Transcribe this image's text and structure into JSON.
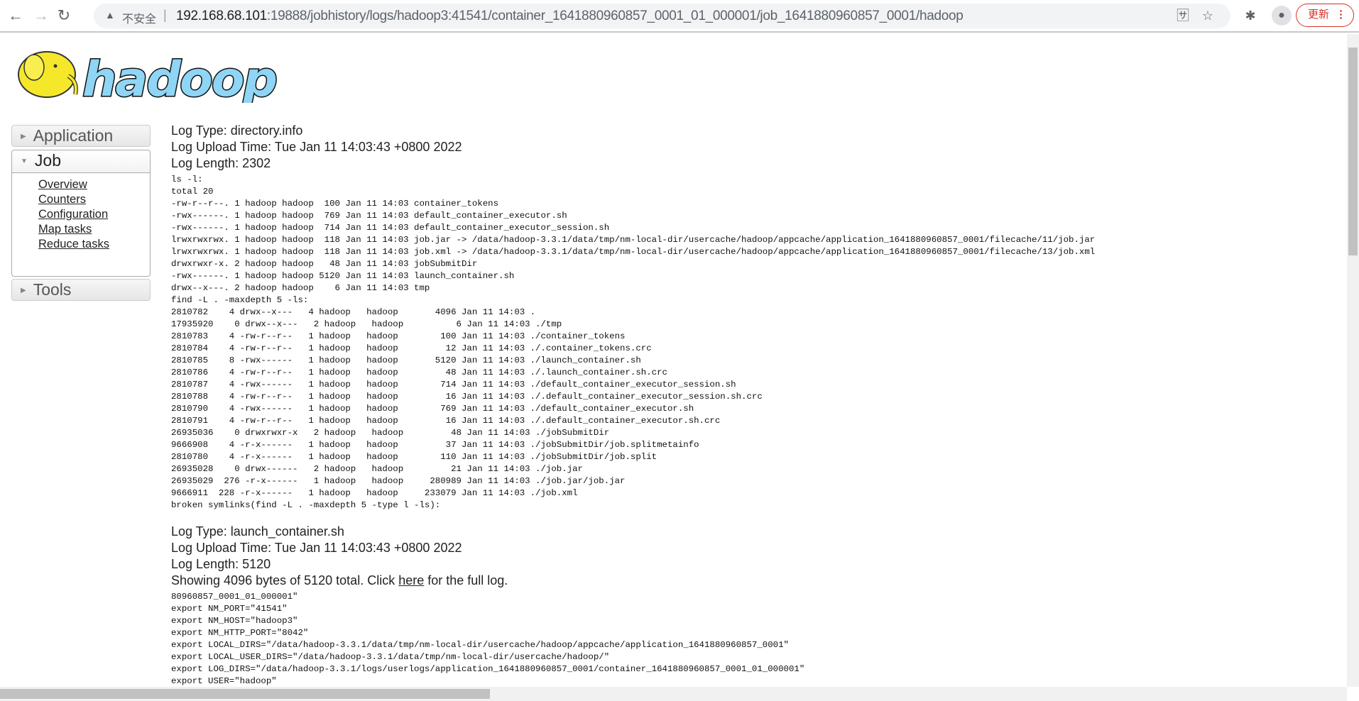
{
  "browser": {
    "security_label": "不安全",
    "url_host": "192.168.68.101",
    "url_rest": ":19888/jobhistory/logs/hadoop3:41541/container_1641880960857_0001_01_000001/job_1641880960857_0001/hadoop",
    "update_label": "更新"
  },
  "logo": {
    "text": "hadoop"
  },
  "sidebar": {
    "application": "Application",
    "job": "Job",
    "job_links": [
      "Overview",
      "Counters",
      "Configuration",
      "Map tasks",
      "Reduce tasks"
    ],
    "tools": "Tools"
  },
  "logs": [
    {
      "type": "Log Type: directory.info",
      "upload_time": "Log Upload Time: Tue Jan 11 14:03:43 +0800 2022",
      "length": "Log Length: 2302",
      "lines": [
        "ls -l:",
        "total 20",
        "-rw-r--r--. 1 hadoop hadoop  100 Jan 11 14:03 container_tokens",
        "-rwx------. 1 hadoop hadoop  769 Jan 11 14:03 default_container_executor.sh",
        "-rwx------. 1 hadoop hadoop  714 Jan 11 14:03 default_container_executor_session.sh",
        "lrwxrwxrwx. 1 hadoop hadoop  118 Jan 11 14:03 job.jar -> /data/hadoop-3.3.1/data/tmp/nm-local-dir/usercache/hadoop/appcache/application_1641880960857_0001/filecache/11/job.jar",
        "lrwxrwxrwx. 1 hadoop hadoop  118 Jan 11 14:03 job.xml -> /data/hadoop-3.3.1/data/tmp/nm-local-dir/usercache/hadoop/appcache/application_1641880960857_0001/filecache/13/job.xml",
        "drwxrwxr-x. 2 hadoop hadoop   48 Jan 11 14:03 jobSubmitDir",
        "-rwx------. 1 hadoop hadoop 5120 Jan 11 14:03 launch_container.sh",
        "drwx--x---. 2 hadoop hadoop    6 Jan 11 14:03 tmp",
        "find -L . -maxdepth 5 -ls:",
        "2810782    4 drwx--x---   4 hadoop   hadoop       4096 Jan 11 14:03 .",
        "17935920    0 drwx--x---   2 hadoop   hadoop          6 Jan 11 14:03 ./tmp",
        "2810783    4 -rw-r--r--   1 hadoop   hadoop        100 Jan 11 14:03 ./container_tokens",
        "2810784    4 -rw-r--r--   1 hadoop   hadoop         12 Jan 11 14:03 ./.container_tokens.crc",
        "2810785    8 -rwx------   1 hadoop   hadoop       5120 Jan 11 14:03 ./launch_container.sh",
        "2810786    4 -rw-r--r--   1 hadoop   hadoop         48 Jan 11 14:03 ./.launch_container.sh.crc",
        "2810787    4 -rwx------   1 hadoop   hadoop        714 Jan 11 14:03 ./default_container_executor_session.sh",
        "2810788    4 -rw-r--r--   1 hadoop   hadoop         16 Jan 11 14:03 ./.default_container_executor_session.sh.crc",
        "2810790    4 -rwx------   1 hadoop   hadoop        769 Jan 11 14:03 ./default_container_executor.sh",
        "2810791    4 -rw-r--r--   1 hadoop   hadoop         16 Jan 11 14:03 ./.default_container_executor.sh.crc",
        "26935036    0 drwxrwxr-x   2 hadoop   hadoop         48 Jan 11 14:03 ./jobSubmitDir",
        "9666908    4 -r-x------   1 hadoop   hadoop         37 Jan 11 14:03 ./jobSubmitDir/job.splitmetainfo",
        "2810780    4 -r-x------   1 hadoop   hadoop        110 Jan 11 14:03 ./jobSubmitDir/job.split",
        "26935028    0 drwx------   2 hadoop   hadoop         21 Jan 11 14:03 ./job.jar",
        "26935029  276 -r-x------   1 hadoop   hadoop     280989 Jan 11 14:03 ./job.jar/job.jar",
        "9666911  228 -r-x------   1 hadoop   hadoop     233079 Jan 11 14:03 ./job.xml",
        "broken symlinks(find -L . -maxdepth 5 -type l -ls):"
      ]
    },
    {
      "type": "Log Type: launch_container.sh",
      "upload_time": "Log Upload Time: Tue Jan 11 14:03:43 +0800 2022",
      "length": "Log Length: 5120",
      "showing_prefix": "Showing 4096 bytes of 5120 total. Click ",
      "showing_link": "here",
      "showing_suffix": " for the full log.",
      "lines": [
        "80960857_0001_01_000001\"",
        "export NM_PORT=\"41541\"",
        "export NM_HOST=\"hadoop3\"",
        "export NM_HTTP_PORT=\"8042\"",
        "export LOCAL_DIRS=\"/data/hadoop-3.3.1/data/tmp/nm-local-dir/usercache/hadoop/appcache/application_1641880960857_0001\"",
        "export LOCAL_USER_DIRS=\"/data/hadoop-3.3.1/data/tmp/nm-local-dir/usercache/hadoop/\"",
        "export LOG_DIRS=\"/data/hadoop-3.3.1/logs/userlogs/application_1641880960857_0001/container_1641880960857_0001_01_000001\"",
        "export USER=\"hadoop\""
      ]
    }
  ]
}
